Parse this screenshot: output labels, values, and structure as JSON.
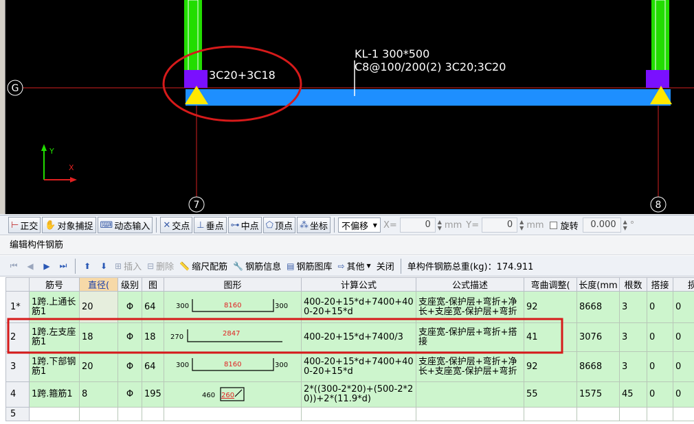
{
  "canvas": {
    "axis_labels": {
      "g": "G",
      "seven": "7",
      "eight": "8"
    },
    "beam_label_line1": "KL-1 300*500",
    "beam_label_line2": "C8@100/200(2) 3C20;3C20",
    "support_rebar_label": "3C20+3C18",
    "ucs_y": "Y",
    "ucs_x": "X",
    "colors": {
      "column": "#22dd00",
      "beam": "#1e8fff",
      "support": "#7a10ff",
      "marker": "#ffe800",
      "axis_line": "#d32020",
      "annotation": "#d61a1a"
    }
  },
  "snapbar": {
    "ortho": "正交",
    "osnap": "对象捕捉",
    "dynin": "动态输入",
    "intersection": "交点",
    "perpendicular": "垂点",
    "midpoint": "中点",
    "vertex": "顶点",
    "coordinate": "坐标",
    "offset_mode": "不偏移",
    "x_label": "X=",
    "x_value": "0",
    "mm1": "mm",
    "y_label": "Y=",
    "y_value": "0",
    "mm2": "mm",
    "rotate_label": "旋转",
    "rotate_value": "0.000",
    "degree": "°"
  },
  "panel": {
    "title": "编辑构件钢筋"
  },
  "edit_toolbar": {
    "insert": "插入",
    "delete": "删除",
    "scale_rebar": "缩尺配筋",
    "rebar_info": "钢筋信息",
    "rebar_library": "钢筋图库",
    "other": "其他",
    "close": "关闭",
    "total_weight": "单构件钢筋总重(kg)：174.911"
  },
  "table": {
    "headers": [
      "",
      "筋号",
      "直径(",
      "级别",
      "图",
      "图形",
      "计算公式",
      "公式描述",
      "弯曲调整(",
      "长度(mm",
      "根数",
      "搭接",
      "损耗"
    ],
    "rows": [
      {
        "idx": "1*",
        "name": "1跨.上通长筋1",
        "dia": "20",
        "grade": "Φ",
        "fig": "64",
        "shape": {
          "left": "300",
          "mid": "8160",
          "right": "300"
        },
        "formula": "400-20+15*d+7400+400-20+15*d",
        "desc": "支座宽-保护层+弯折+净长+支座宽-保护层+弯折",
        "bend": "92",
        "len": "8668",
        "count": "3",
        "lap": "0",
        "loss": "0"
      },
      {
        "idx": "2",
        "name": "1跨.左支座筋1",
        "dia": "18",
        "grade": "Φ",
        "fig": "18",
        "shape": {
          "left": "270",
          "mid": "2847"
        },
        "formula": "400-20+15*d+7400/3",
        "desc": "支座宽-保护层+弯折+搭接",
        "bend": "41",
        "len": "3076",
        "count": "3",
        "lap": "0",
        "loss": "0"
      },
      {
        "idx": "3",
        "name": "1跨.下部钢筋1",
        "dia": "20",
        "grade": "Φ",
        "fig": "64",
        "shape": {
          "left": "300",
          "mid": "8160",
          "right": "300"
        },
        "formula": "400-20+15*d+7400+400-20+15*d",
        "desc": "支座宽-保护层+弯折+净长+支座宽-保护层+弯折",
        "bend": "92",
        "len": "8668",
        "count": "3",
        "lap": "0",
        "loss": "0"
      },
      {
        "idx": "4",
        "name": "1跨.箍筋1",
        "dia": "8",
        "grade": "Φ",
        "fig": "195",
        "shape": {
          "left": "460",
          "mid": "260"
        },
        "formula": "2*((300-2*20)+(500-2*20))+2*(11.9*d)",
        "desc": "",
        "bend": "55",
        "len": "1575",
        "count": "45",
        "lap": "0",
        "loss": "0"
      },
      {
        "idx": "5"
      }
    ]
  }
}
